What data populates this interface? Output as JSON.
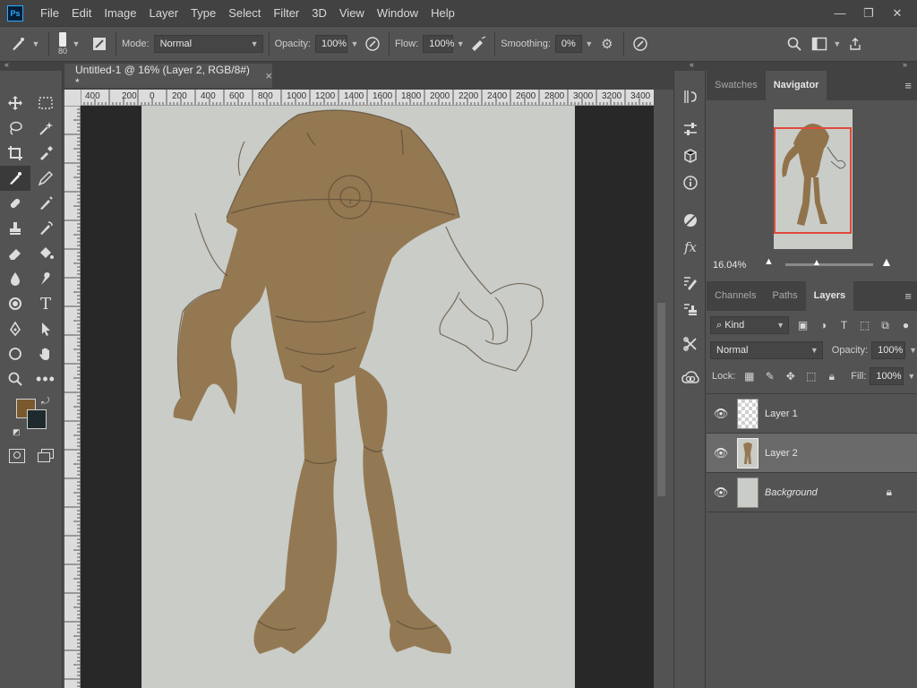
{
  "app": {
    "logo_text": "Ps",
    "menu": [
      "File",
      "Edit",
      "Image",
      "Layer",
      "Type",
      "Select",
      "Filter",
      "3D",
      "View",
      "Window",
      "Help"
    ],
    "window_controls": [
      "—",
      "❐",
      "✕"
    ]
  },
  "options_bar": {
    "brush_size": "80",
    "mode_label": "Mode:",
    "mode_value": "Normal",
    "opacity_label": "Opacity:",
    "opacity_value": "100%",
    "flow_label": "Flow:",
    "flow_value": "100%",
    "smoothing_label": "Smoothing:",
    "smoothing_value": "0%"
  },
  "document": {
    "tab_title": "Untitled-1 @ 16% (Layer 2, RGB/8#) *",
    "tab_close": "×",
    "ruler_top_labels": [
      "400",
      "200",
      "0",
      "200",
      "400",
      "600",
      "800",
      "1000",
      "1200",
      "1400",
      "1600",
      "1800",
      "2000",
      "2200",
      "2400",
      "2600",
      "2800",
      "3000",
      "3200",
      "3400"
    ]
  },
  "colors": {
    "foreground": "#7a5a2c",
    "background": "#1e2a2e",
    "paint": "#8a6a3e",
    "accent_red": "#e0493c"
  },
  "navigator": {
    "tabs": [
      "Swatches",
      "Navigator"
    ],
    "active_tab": "Navigator",
    "zoom": "16.04%"
  },
  "layers_panel": {
    "tabs": [
      "Channels",
      "Paths",
      "Layers"
    ],
    "active_tab": "Layers",
    "kind_label": "Kind",
    "blend_mode": "Normal",
    "opacity_label": "Opacity:",
    "opacity_value": "100%",
    "lock_label": "Lock:",
    "fill_label": "Fill:",
    "fill_value": "100%",
    "layers": [
      {
        "name": "Layer 1",
        "selected": false,
        "locked": false,
        "italic": false
      },
      {
        "name": "Layer 2",
        "selected": true,
        "locked": false,
        "italic": false
      },
      {
        "name": "Background",
        "selected": false,
        "locked": true,
        "italic": true
      }
    ]
  }
}
